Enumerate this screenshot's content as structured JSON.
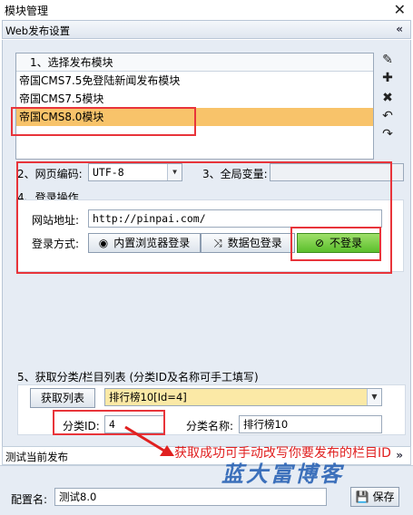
{
  "window": {
    "title": "模块管理",
    "close_glyph": "✕"
  },
  "section_web": {
    "label": "Web发布设置",
    "chevron": "«"
  },
  "module_list": {
    "header": "1、选择发布模块",
    "items": [
      {
        "label": "帝国CMS7.5免登陆新闻发布模块"
      },
      {
        "label": "帝国CMS7.5模块"
      },
      {
        "label": "帝国CMS8.0模块"
      }
    ]
  },
  "side_actions": [
    {
      "icon": "pencil-icon",
      "glyph": "✎"
    },
    {
      "icon": "plus-icon",
      "glyph": "✚"
    },
    {
      "icon": "delete-icon",
      "glyph": "✖"
    },
    {
      "icon": "undo-icon",
      "glyph": "↶"
    },
    {
      "icon": "redo-icon",
      "glyph": "↷"
    }
  ],
  "encoding": {
    "label": "2、网页编码:",
    "value": "UTF-8"
  },
  "global_var": {
    "label": "3、全局变量:",
    "value": ""
  },
  "login": {
    "section_label": "4、登录操作",
    "site_label": "网站地址:",
    "site_value": "http://pinpai.com/",
    "method_label": "登录方式:",
    "buttons": [
      {
        "label": "内置浏览器登录",
        "glyph": "◉"
      },
      {
        "label": "数据包登录",
        "glyph": "⤨"
      },
      {
        "label": "不登录",
        "glyph": "⊘"
      }
    ]
  },
  "category": {
    "section_label": "5、获取分类/栏目列表 (分类ID及名称可手工填写)",
    "fetch_button": "获取列表",
    "selected": "排行榜10[Id=4]",
    "id_label": "分类ID:",
    "id_value": "4",
    "name_label": "分类名称:",
    "name_value": "排行榜10"
  },
  "section_test": {
    "label": "测试当前发布"
  },
  "footer": {
    "config_label": "配置名:",
    "config_value": "测试8.0",
    "save_button": "保存",
    "save_glyph": "💾"
  },
  "annotation": {
    "text": "获取成功可手动改写你要发布的栏目ID"
  },
  "watermark": {
    "text": "蓝大富博客"
  },
  "colors": {
    "annotation_red": "#e8343a",
    "selected_row": "#f8c36a",
    "no_login_green": "#5bbf2c"
  }
}
